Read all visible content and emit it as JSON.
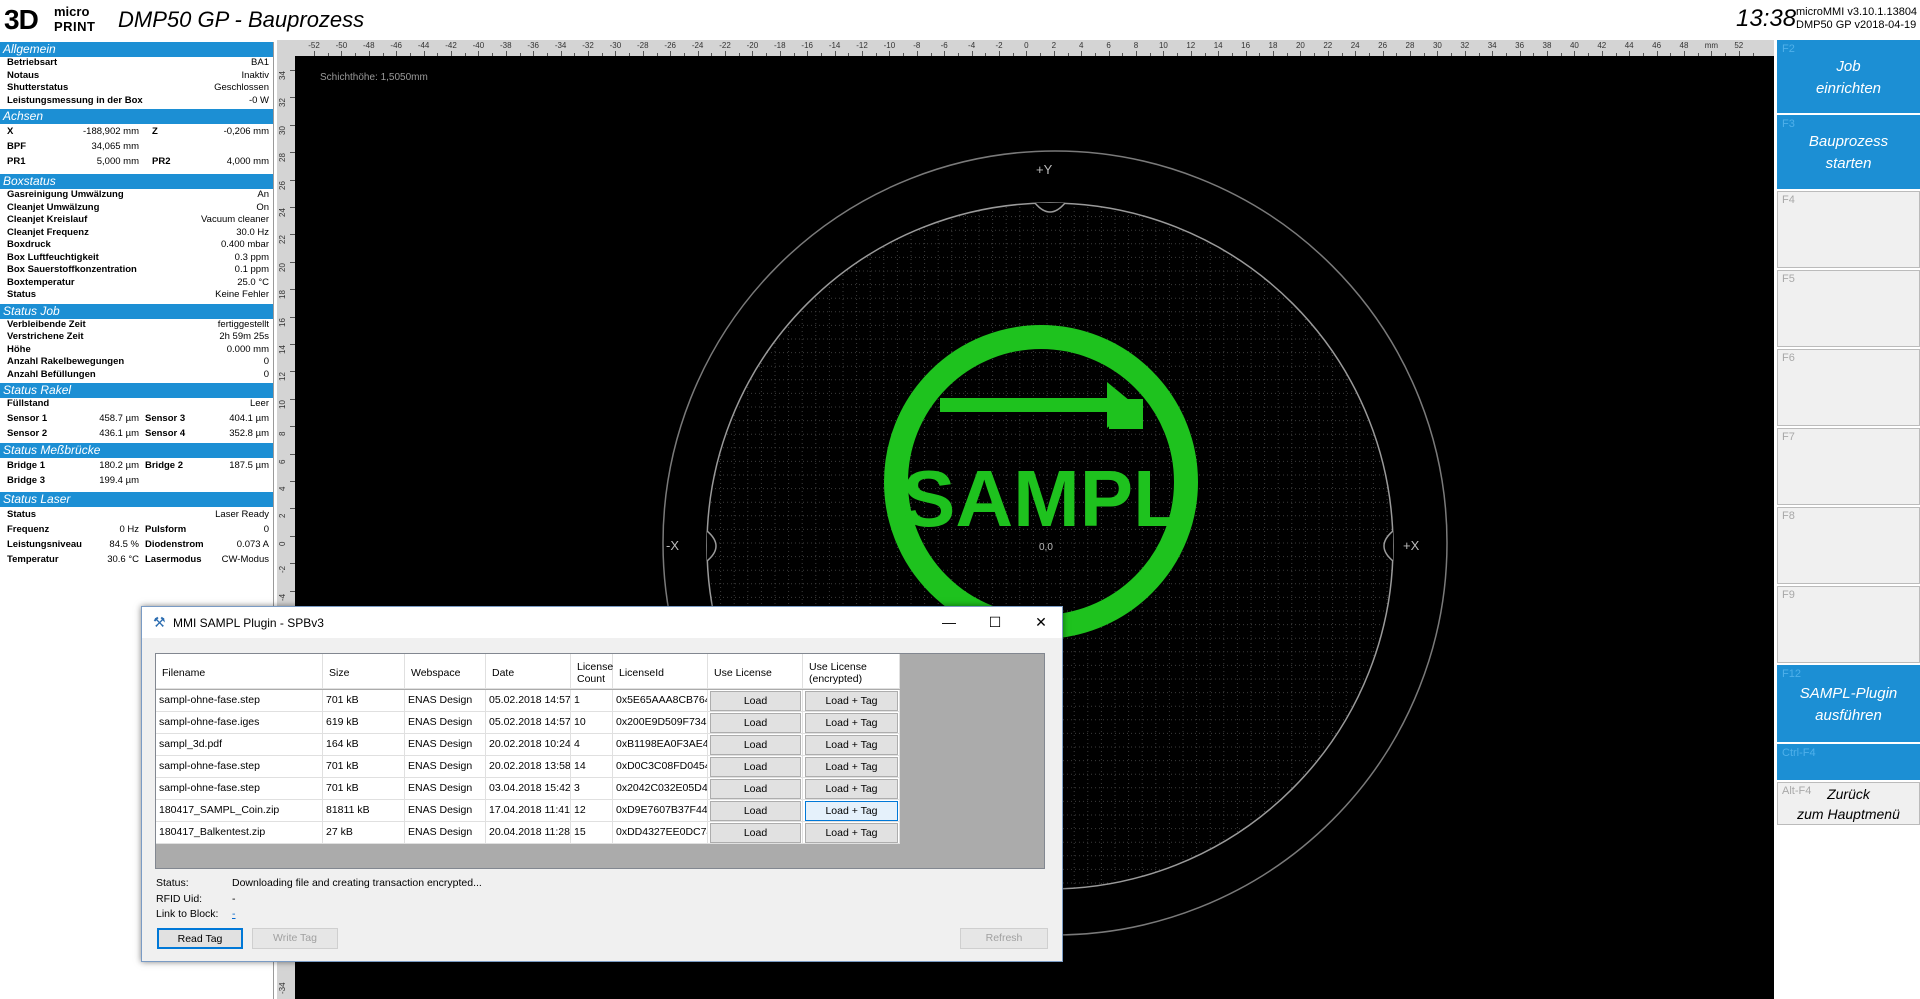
{
  "header": {
    "logo_big": "3D",
    "logo_small1": "micro",
    "logo_small2": "PRINT",
    "title": "DMP50 GP - Bauprozess",
    "clock": "13:38",
    "version1": "microMMI v3.10.1.13804",
    "version2": "DMP50 GP v2018-04-19"
  },
  "sections": {
    "allgemein": {
      "title": "Allgemein",
      "rows": [
        {
          "label": "Betriebsart",
          "value": "BA1"
        },
        {
          "label": "Notaus",
          "value": "Inaktiv"
        },
        {
          "label": "Shutterstatus",
          "value": "Geschlossen"
        },
        {
          "label": "Leistungsmessung in der Box",
          "value": "-0 W"
        }
      ]
    },
    "achsen": {
      "title": "Achsen",
      "x_label": "X",
      "x_value": "-188,902 mm",
      "z_label": "Z",
      "z_value": "-0,206 mm",
      "bpf_label": "BPF",
      "bpf_value": "34,065 mm",
      "pr1_label": "PR1",
      "pr1_value": "5,000 mm",
      "pr2_label": "PR2",
      "pr2_value": "4,000 mm"
    },
    "boxstatus": {
      "title": "Boxstatus",
      "rows": [
        {
          "label": "Gasreinigung Umwälzung",
          "value": "An"
        },
        {
          "label": "Cleanjet Umwälzung",
          "value": "On"
        },
        {
          "label": "Cleanjet Kreislauf",
          "value": "Vacuum cleaner"
        },
        {
          "label": "Cleanjet Frequenz",
          "value": "30.0 Hz"
        },
        {
          "label": "Boxdruck",
          "value": "0.400 mbar"
        },
        {
          "label": "Box Luftfeuchtigkeit",
          "value": "0.3 ppm"
        },
        {
          "label": "Box Sauerstoffkonzentration",
          "value": "0.1 ppm"
        },
        {
          "label": "Boxtemperatur",
          "value": "25.0 °C"
        },
        {
          "label": "Status",
          "value": "Keine Fehler"
        }
      ]
    },
    "statusjob": {
      "title": "Status Job",
      "rows": [
        {
          "label": "Verbleibende Zeit",
          "value": "fertiggestellt"
        },
        {
          "label": "Verstrichene Zeit",
          "value": "2h 59m 25s"
        },
        {
          "label": "Höhe",
          "value": "0.000 mm"
        },
        {
          "label": "Anzahl Rakelbewegungen",
          "value": "0"
        },
        {
          "label": "Anzahl Befüllungen",
          "value": "0"
        }
      ]
    },
    "rakel": {
      "title": "Status Rakel",
      "fill_label": "Füllstand",
      "fill_value": "Leer",
      "s1_label": "Sensor 1",
      "s1_value": "458.7 µm",
      "s3_label": "Sensor 3",
      "s3_value": "404.1 µm",
      "s2_label": "Sensor 2",
      "s2_value": "436.1 µm",
      "s4_label": "Sensor 4",
      "s4_value": "352.8 µm"
    },
    "messbruecke": {
      "title": "Status Meßbrücke",
      "b1_label": "Bridge 1",
      "b1_value": "180.2 µm",
      "b2_label": "Bridge 2",
      "b2_value": "187.5 µm",
      "b3_label": "Bridge 3",
      "b3_value": "199.4 µm"
    },
    "laser": {
      "title": "Status Laser",
      "status_label": "Status",
      "status_value": "Laser Ready",
      "freq_label": "Frequenz",
      "freq_value": "0 Hz",
      "puls_label": "Pulsform",
      "puls_value": "0",
      "lvl_label": "Leistungsniveau",
      "lvl_value": "84.5 %",
      "diode_label": "Diodenstrom",
      "diode_value": "0.073 A",
      "temp_label": "Temperatur",
      "temp_value": "30.6 °C",
      "mode_label": "Lasermodus",
      "mode_value": "CW-Modus"
    }
  },
  "canvas": {
    "layer_height": "Schichthöhe: 1,5050mm",
    "ruler_top_ticks": [
      "-52",
      "-50",
      "-48",
      "-46",
      "-44",
      "-42",
      "-40",
      "-38",
      "-36",
      "-34",
      "-32",
      "-30",
      "-28",
      "-26",
      "-24",
      "-22",
      "-20",
      "-18",
      "-16",
      "-14",
      "-12",
      "-10",
      "-8",
      "-6",
      "-4",
      "-2",
      "0",
      "2",
      "4",
      "6",
      "8",
      "10",
      "12",
      "14",
      "16",
      "18",
      "20",
      "22",
      "24",
      "26",
      "28",
      "30",
      "32",
      "34",
      "36",
      "38",
      "40",
      "42",
      "44",
      "46",
      "48",
      "mm",
      "52"
    ],
    "ruler_left_ticks": [
      "34",
      "32",
      "30",
      "28",
      "26",
      "24",
      "22",
      "20",
      "18",
      "16",
      "14",
      "12",
      "10",
      "8",
      "6",
      "4",
      "2",
      "0",
      "-2",
      "-4"
    ],
    "ruler_left_bottom": "-34",
    "axis_py": "+Y",
    "axis_mx": "-X",
    "axis_px": "+X",
    "center": "0,0",
    "logo_text": "SAMPL",
    "logo_color": "#1ec21e"
  },
  "fkeys": [
    {
      "code": "F2",
      "label1": "Job",
      "label2": "einrichten"
    },
    {
      "code": "F3",
      "label1": "Bauprozess",
      "label2": "starten"
    },
    {
      "code": "F4"
    },
    {
      "code": "F5"
    },
    {
      "code": "F6"
    },
    {
      "code": "F7"
    },
    {
      "code": "F8"
    },
    {
      "code": "F9"
    },
    {
      "code": "F12",
      "label1": "SAMPL-Plugin",
      "label2": "ausführen"
    },
    {
      "code": "Ctrl-F4"
    },
    {
      "code": "Alt-F4",
      "label1": "Zurück",
      "label2": "zum Hauptmenü"
    }
  ],
  "dialog": {
    "title": "MMI SAMPL Plugin - SPBv3",
    "columns": [
      "Filename",
      "Size",
      "Webspace",
      "Date",
      "License Count",
      "LicenseId",
      "Use License",
      "Use License (encrypted)"
    ],
    "rows": [
      {
        "filename": "sampl-ohne-fase.step",
        "size": "701 kB",
        "webspace": "ENAS Design",
        "date": "05.02.2018 14:57...",
        "count": "1",
        "id": "0x5E65AAA8CB764...",
        "load": "Load",
        "tag": "Load + Tag"
      },
      {
        "filename": "sampl-ohne-fase.iges",
        "size": "619 kB",
        "webspace": "ENAS Design",
        "date": "05.02.2018 14:57...",
        "count": "10",
        "id": "0x200E9D509F7345...",
        "load": "Load",
        "tag": "Load + Tag"
      },
      {
        "filename": "sampl_3d.pdf",
        "size": "164 kB",
        "webspace": "ENAS Design",
        "date": "20.02.2018 10:24...",
        "count": "4",
        "id": "0xB1198EA0F3AE4...",
        "load": "Load",
        "tag": "Load + Tag"
      },
      {
        "filename": "sampl-ohne-fase.step",
        "size": "701 kB",
        "webspace": "ENAS Design",
        "date": "20.02.2018 13:58...",
        "count": "14",
        "id": "0xD0C3C08FD0454...",
        "load": "Load",
        "tag": "Load + Tag"
      },
      {
        "filename": "sampl-ohne-fase.step",
        "size": "701 kB",
        "webspace": "ENAS Design",
        "date": "03.04.2018 15:42...",
        "count": "3",
        "id": "0x2042C032E05D4...",
        "load": "Load",
        "tag": "Load + Tag"
      },
      {
        "filename": "180417_SAMPL_Coin.zip",
        "size": "81811 kB",
        "webspace": "ENAS Design",
        "date": "17.04.2018 11:41...",
        "count": "12",
        "id": "0xD9E7607B37F44...",
        "load": "Load",
        "tag": "Load + Tag"
      },
      {
        "filename": "180417_Balkentest.zip",
        "size": "27 kB",
        "webspace": "ENAS Design",
        "date": "20.04.2018 11:28...",
        "count": "15",
        "id": "0xDD4327EE0DC74...",
        "load": "Load",
        "tag": "Load + Tag"
      }
    ],
    "status_label": "Status:",
    "status_value": "Downloading file and creating transaction encrypted...",
    "rfid_label": "RFID Uid:",
    "rfid_value": "-",
    "link_label": "Link to Block:",
    "link_value": "-",
    "read_tag": "Read Tag",
    "write_tag": "Write Tag",
    "refresh": "Refresh"
  }
}
